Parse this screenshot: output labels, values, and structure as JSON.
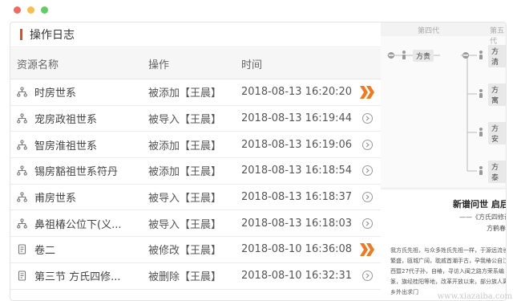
{
  "window": {
    "controls": [
      "close",
      "minimize",
      "maximize"
    ]
  },
  "panel": {
    "title": "操作日志",
    "accent_color": "#e8491f"
  },
  "table": {
    "headers": {
      "name": "资源名称",
      "operation": "操作",
      "time": "时间"
    },
    "rows": [
      {
        "icon": "tree-icon",
        "name": "时房世系",
        "operation": "被添加【王晨】",
        "time": "2018-08-13 16:20:20",
        "action": "double-chevron"
      },
      {
        "icon": "tree-icon",
        "name": "宠房政祖世系",
        "operation": "被导入【王晨】",
        "time": "2018-08-13 16:19:44",
        "action": "circle-chevron"
      },
      {
        "icon": "tree-icon",
        "name": "智房淮祖世系",
        "operation": "被添加【王晨】",
        "time": "2018-08-13 16:19:06",
        "action": "circle-chevron"
      },
      {
        "icon": "tree-icon",
        "name": "锡房豁祖世系符丹",
        "operation": "被添加【王晨】",
        "time": "2018-08-13 16:18:54",
        "action": "circle-chevron"
      },
      {
        "icon": "tree-icon",
        "name": "甫房世系",
        "operation": "被导入【王晨】",
        "time": "2018-08-13 16:18:37",
        "action": "circle-chevron"
      },
      {
        "icon": "tree-icon",
        "name": "鼻祖椿公位下(义...",
        "operation": "被导入【王晨】",
        "time": "2018-08-13 16:18:03",
        "action": "circle-chevron"
      },
      {
        "icon": "document-icon",
        "name": "卷二",
        "operation": "被修改【王晨】",
        "time": "2018-08-10 16:36:08",
        "action": "double-chevron"
      },
      {
        "icon": "document-icon",
        "name": "第三节 方氏四修...",
        "operation": "被删除【王晨】",
        "time": "2018-08-10 16:32:31",
        "action": "circle-chevron"
      }
    ]
  },
  "preview": {
    "generations": [
      "第四代",
      "第五代"
    ],
    "root_node": "方贵",
    "child_nodes": [
      "方清",
      "方寓",
      "方安",
      "方泰"
    ],
    "document": {
      "title": "新谱问世 启后",
      "subtitle": "——《方氏四修谱》",
      "author": "方鹤春",
      "text": "我方氏先祖，与众多姓氏先祖一样，于源远流长繁盛，瓯城广阔，耽戚首潮手古，孕我椿公自江西暨27代子孙，自椿，寻访入闽之路方荣系编篆，旗经桂阳等地，改革开放以来，部分族人离乡外出求门"
    },
    "watermark": "www.xiazaiba.com"
  },
  "colors": {
    "highlight_arrow": "#f07a1f",
    "border": "#e4e4e4"
  }
}
